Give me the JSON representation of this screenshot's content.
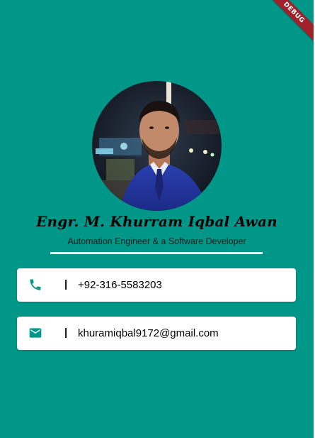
{
  "debug_banner": {
    "label": "DEBUG"
  },
  "profile": {
    "name": "Engr. M. Khurram Iqbal Awan",
    "subtitle": "Automation Engineer & a Software Developer"
  },
  "contacts": {
    "phone": {
      "separator": "|",
      "value": "+92-316-5583203",
      "icon": "phone-icon"
    },
    "email": {
      "separator": "|",
      "value": "khuramiqbal9172@gmail.com",
      "icon": "mail-icon"
    }
  },
  "colors": {
    "background": "#009688",
    "card": "#ffffff",
    "icon": "#009688",
    "banner": "#a0202c"
  }
}
